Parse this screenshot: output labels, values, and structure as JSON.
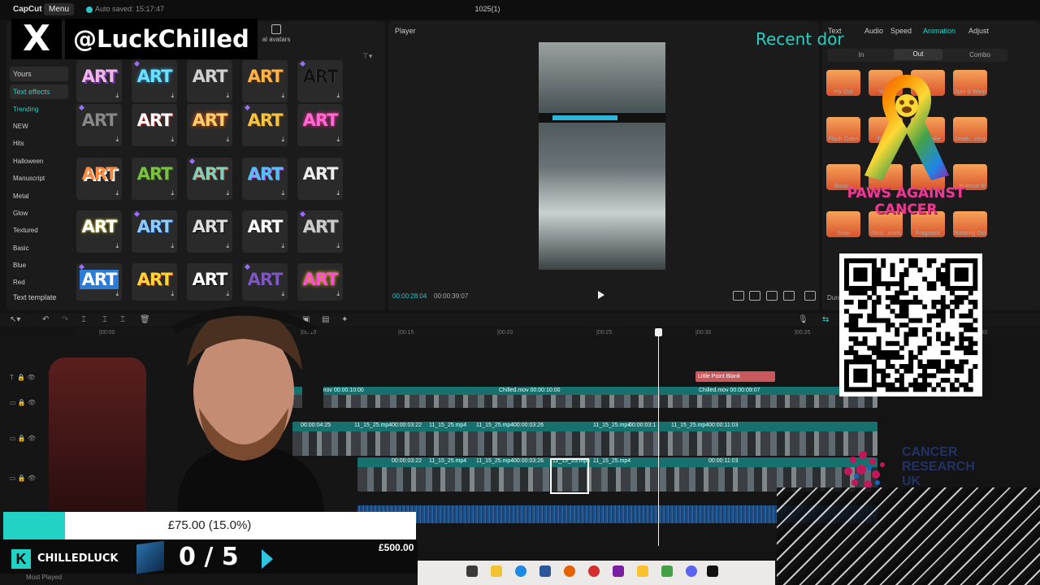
{
  "app": {
    "logo": "CapCut",
    "menu_label": "Menu",
    "autosave": "Auto saved: 15:17:47",
    "project_title": "1025(1)"
  },
  "left_panel": {
    "tab_avatars": "al avatars",
    "categories": [
      "Yours",
      "Text effects"
    ],
    "subcategories": [
      "Trending",
      "NEW",
      "Hits",
      "Halloween",
      "Manuscript",
      "Metal",
      "Glow",
      "Textured",
      "Basic",
      "Blue",
      "Red"
    ],
    "text_template": "Text template",
    "tile_word": "ART"
  },
  "player": {
    "title": "Player",
    "time_current": "00:00:28:04",
    "time_total": "00:00:39:07"
  },
  "right_panel": {
    "tabs": [
      "Text",
      "Audio",
      "Speed",
      "Animation",
      "Adjust"
    ],
    "anim_tabs": [
      "In",
      "Out",
      "Combo"
    ],
    "anim_labels": [
      "Fly Out",
      "Wa...",
      "",
      "Spin & Warp",
      "Flash Outro",
      "Pixel...",
      "...s Shake",
      "Death...tring",
      "Boun...",
      "",
      "",
      "...bulence III",
      "Scan",
      "Vibra...anels",
      "Fragment",
      "Rotating Out"
    ],
    "duration_label": "Dura"
  },
  "timeline": {
    "ticks": [
      "|00:00",
      "|00:10",
      "|00:15",
      "|00:20",
      "|00:25",
      "|00:30",
      "|00:35",
      "|00:40"
    ],
    "text_clip": "Little Point Blank",
    "overlay_track_labels": [
      "...d.mov  00:00:10:00",
      "Chilled.mov  00:00:10:00",
      "Chilled.mov  00:00:09:07"
    ],
    "video_labels": [
      "00:00:04:25",
      "11_15_25.mp4",
      "00:00:03:22",
      "11_15_25.mp4",
      "11_15_25.mp4",
      "00:00:03:26",
      "11_15_25.mp4",
      "00:00:03:1",
      "11_15_25.mp4",
      "00:00:11:03"
    ]
  },
  "overlays": {
    "x_logo": "X",
    "handle": "@LuckChilled",
    "recent_donor": "Recent dor",
    "paws_line1": "PAWS AGAINST",
    "paws_line2": "CANCER",
    "cancer_research": [
      "CANCER",
      "RESEARCH",
      "UK"
    ]
  },
  "goal": {
    "amount_text": "£75.00 (15.0%)",
    "progress_fraction": 0.15,
    "target": "£500.00",
    "brand_name": "CHILLEDLUCK",
    "counter": "0 / 5"
  },
  "desktop": {
    "label": "Most Played"
  },
  "colors": {
    "accent": "#22d3c5",
    "text_clip": "#c9585c",
    "track": "#16706d"
  }
}
